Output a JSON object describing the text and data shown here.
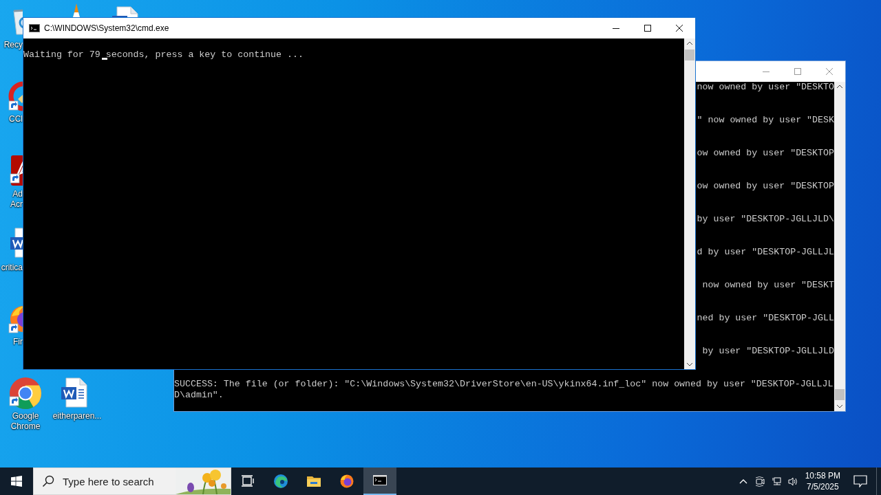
{
  "desktop_icons": [
    {
      "kind": "recycle-bin",
      "label_lines": [
        "Recy"
      ],
      "shortcut": false
    },
    {
      "kind": "cone"
    },
    {
      "kind": "document"
    },
    {
      "kind": "cleaner",
      "label_lines": [
        "CCl"
      ],
      "shortcut": true
    },
    {
      "kind": "pdf",
      "label_lines": [
        "Ad",
        "Acr"
      ],
      "shortcut": true
    },
    {
      "kind": "document",
      "label_lines": [
        "critica"
      ],
      "shortcut": false
    },
    {
      "kind": "firefox",
      "label_lines": [
        "Fir"
      ],
      "shortcut": true
    },
    {
      "kind": "chrome",
      "label_lines": [
        "Google",
        "Chrome"
      ],
      "shortcut": true
    },
    {
      "kind": "document",
      "label_lines": [
        "eitherparen..."
      ],
      "shortcut": false
    }
  ],
  "windows": [
    {
      "kind": "console",
      "active": false,
      "lines": [
        {
          "kind": "tail",
          "text": "now owned by user \"DESKTO"
        },
        {
          "kind": "tail",
          "text": "\" now owned by user \"DESK"
        },
        {
          "kind": "tail",
          "text": "ow owned by user \"DESKTOP"
        },
        {
          "kind": "tail",
          "text": "ow owned by user \"DESKTOP"
        },
        {
          "kind": "tail",
          "text": "by user \"DESKTOP-JGLLJLD\\"
        },
        {
          "kind": "tail",
          "text": "d by user \"DESKTOP-JGLLJL"
        },
        {
          "kind": "tail",
          "text": "now owned by user \"DESKT"
        },
        {
          "kind": "tail",
          "text": "ned by user \"DESKTOP-JGLL"
        },
        {
          "kind": "tail",
          "text": "by user \"DESKTOP-JGLLJLD"
        },
        {
          "kind": "full",
          "text": "SUCCESS: The file (or folder): \"C:\\Windows\\System32\\DriverStore\\en-US\\ykinx64.inf_loc\" now owned by user \"DESKTOP-JGLLJL"
        },
        {
          "kind": "full",
          "text": "D\\admin\"."
        }
      ]
    },
    {
      "kind": "console",
      "active": true,
      "title": "C:\\WINDOWS\\System32\\cmd.exe",
      "cursor": true,
      "lines": [
        {
          "kind": "full",
          "text": "Waiting for 79 seconds, press a key to continue ..."
        }
      ]
    }
  ],
  "taskbar": {
    "search": {
      "placeholder": "Type here to search"
    },
    "apps": [
      {
        "kind": "task-view",
        "active": false
      },
      {
        "kind": "edge",
        "active": false
      },
      {
        "kind": "explorer",
        "active": false
      },
      {
        "kind": "firefox",
        "active": false
      },
      {
        "kind": "terminal",
        "active": true
      }
    ],
    "clock": {
      "time": "10:58 PM",
      "date": "7/5/2025"
    }
  }
}
